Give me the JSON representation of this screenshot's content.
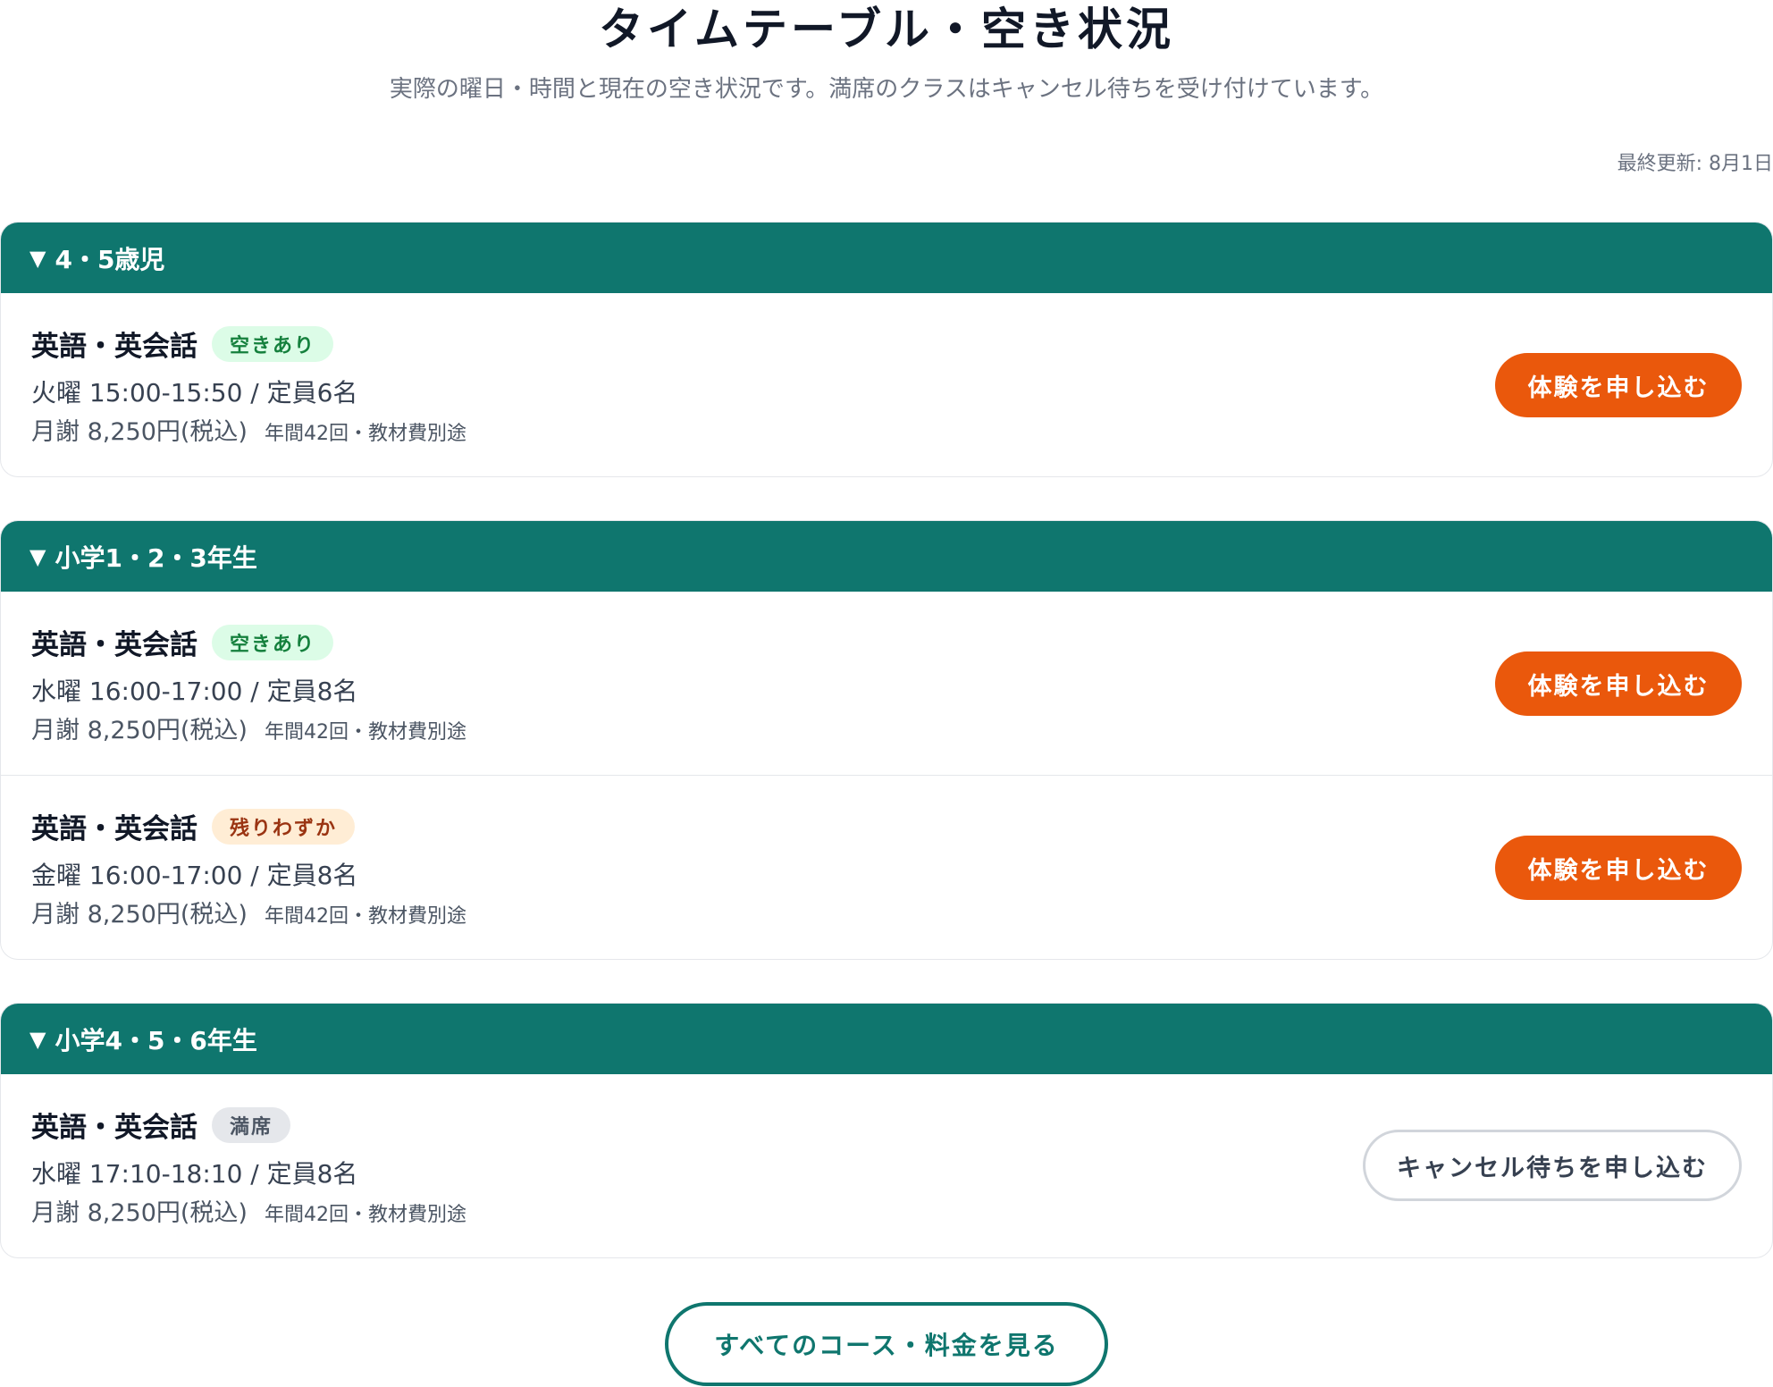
{
  "header": {
    "title": "タイムテーブル・空き状況",
    "subtitle": "実際の曜日・時間と現在の空き状況です。満席のクラスはキャンセル待ちを受け付けています。",
    "updated": "最終更新: 8月1日"
  },
  "groups": [
    {
      "label": "4・5歳児",
      "rows": [
        {
          "course": "英語・英会話",
          "status": "空きあり",
          "schedule": "火曜 15:00-15:50 / 定員6名",
          "price": "月謝 8,250円(税込)",
          "note": "年間42回・教材費別途",
          "action": "体験を申し込む"
        }
      ]
    },
    {
      "label": "小学1・2・3年生",
      "rows": [
        {
          "course": "英語・英会話",
          "status": "空きあり",
          "schedule": "水曜 16:00-17:00 / 定員8名",
          "price": "月謝 8,250円(税込)",
          "note": "年間42回・教材費別途",
          "action": "体験を申し込む"
        },
        {
          "course": "英語・英会話",
          "status": "残りわずか",
          "schedule": "金曜 16:00-17:00 / 定員8名",
          "price": "月謝 8,250円(税込)",
          "note": "年間42回・教材費別途",
          "action": "体験を申し込む"
        }
      ]
    },
    {
      "label": "小学4・5・6年生",
      "rows": [
        {
          "course": "英語・英会話",
          "status": "満席",
          "schedule": "水曜 17:10-18:10 / 定員8名",
          "price": "月謝 8,250円(税込)",
          "note": "年間42回・教材費別途",
          "action": "キャンセル待ちを申し込む"
        }
      ]
    }
  ],
  "footer": {
    "all_courses_label": "すべてのコース・料金を見る"
  },
  "colors": {
    "header_bg": "#0f766e",
    "primary_button": "#ea580c",
    "badge_open_bg": "#dcfce7",
    "badge_few_bg": "#ffedd5",
    "badge_full_bg": "#e5e7eb"
  }
}
